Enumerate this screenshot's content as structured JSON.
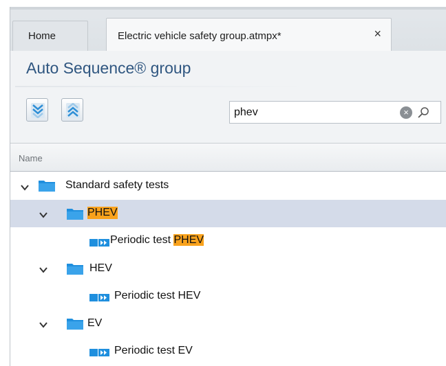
{
  "tabs": [
    {
      "label": "Home"
    },
    {
      "label": "Electric vehicle safety group.atmpx*",
      "close": "×"
    }
  ],
  "panel": {
    "title": "Auto Sequence® group"
  },
  "toolbar": {
    "expand_all": "expand-all",
    "collapse_all": "collapse-all"
  },
  "search": {
    "value": "phev",
    "clear": "×"
  },
  "grid": {
    "column_name": "Name"
  },
  "tree": {
    "root": "Standard safety tests",
    "groups": [
      {
        "label": "PHEV",
        "child_prefix": "Periodic test ",
        "child_match": "PHEV"
      },
      {
        "label": "HEV",
        "child": "Periodic test HEV"
      },
      {
        "label": "EV",
        "child": "Periodic test EV"
      }
    ]
  },
  "colors": {
    "highlight": "#f9a21c",
    "selection": "#d4dbe9",
    "folder": "#1f8fde",
    "title": "#2f5680"
  }
}
